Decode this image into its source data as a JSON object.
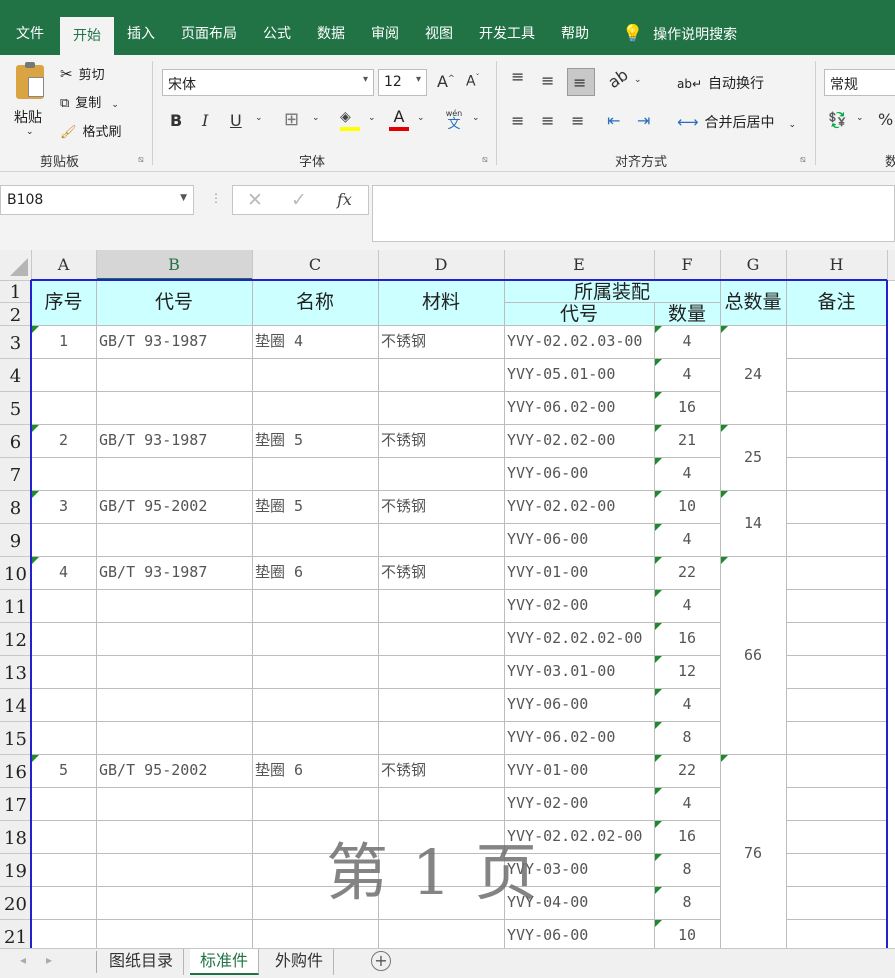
{
  "ribbon_tabs": [
    "文件",
    "开始",
    "插入",
    "页面布局",
    "公式",
    "数据",
    "审阅",
    "视图",
    "开发工具",
    "帮助"
  ],
  "tell_me": "操作说明搜索",
  "clipboard": {
    "paste": "粘贴",
    "cut": "剪切",
    "copy": "复制",
    "format_painter": "格式刷",
    "label": "剪贴板"
  },
  "font": {
    "name": "宋体",
    "size": "12",
    "label": "字体",
    "bold": "B",
    "italic": "I",
    "underline": "U",
    "grow": "A",
    "shrink": "A",
    "phonetic_top": "wén",
    "phonetic_bottom": "文"
  },
  "alignment": {
    "wrap": "自动换行",
    "merge": "合并后居中",
    "label": "对齐方式"
  },
  "number": {
    "format": "常规",
    "label": "数"
  },
  "name_box": "B108",
  "fx": "fx",
  "columns": [
    "A",
    "B",
    "C",
    "D",
    "E",
    "F",
    "G",
    "H"
  ],
  "rows": [
    "1",
    "2",
    "3",
    "4",
    "5",
    "6",
    "7",
    "8",
    "9",
    "10",
    "11",
    "12",
    "13",
    "14",
    "15",
    "16",
    "17",
    "18",
    "19",
    "20",
    "21"
  ],
  "header": {
    "seq": "序号",
    "code": "代号",
    "name": "名称",
    "material": "材料",
    "assembly": "所属装配",
    "asm_code": "代号",
    "qty": "数量",
    "total": "总数量",
    "remark": "备注"
  },
  "items": [
    {
      "seq": "1",
      "code": "GB/T 93-1987",
      "name": "垫圈 4",
      "material": "不锈钢",
      "total": "24",
      "lines": [
        [
          "YVY-02.02.03-00",
          "4"
        ],
        [
          "YVY-05.01-00",
          "4"
        ],
        [
          "YVY-06.02-00",
          "16"
        ]
      ]
    },
    {
      "seq": "2",
      "code": "GB/T 93-1987",
      "name": "垫圈 5",
      "material": "不锈钢",
      "total": "25",
      "lines": [
        [
          "YVY-02.02-00",
          "21"
        ],
        [
          "YVY-06-00",
          "4"
        ]
      ]
    },
    {
      "seq": "3",
      "code": "GB/T 95-2002",
      "name": "垫圈 5",
      "material": "不锈钢",
      "total": "14",
      "lines": [
        [
          "YVY-02.02-00",
          "10"
        ],
        [
          "YVY-06-00",
          "4"
        ]
      ]
    },
    {
      "seq": "4",
      "code": "GB/T 93-1987",
      "name": "垫圈 6",
      "material": "不锈钢",
      "total": "66",
      "lines": [
        [
          "YVY-01-00",
          "22"
        ],
        [
          "YVY-02-00",
          "4"
        ],
        [
          "YVY-02.02.02-00",
          "16"
        ],
        [
          "YVY-03.01-00",
          "12"
        ],
        [
          "YVY-06-00",
          "4"
        ],
        [
          "YVY-06.02-00",
          "8"
        ]
      ]
    },
    {
      "seq": "5",
      "code": "GB/T 95-2002",
      "name": "垫圈 6",
      "material": "不锈钢",
      "total": "76",
      "lines": [
        [
          "YVY-01-00",
          "22"
        ],
        [
          "YVY-02-00",
          "4"
        ],
        [
          "YVY-02.02.02-00",
          "16"
        ],
        [
          "YVY-03-00",
          "8"
        ],
        [
          "YVY-04-00",
          "8"
        ],
        [
          "YVY-06-00",
          "10"
        ]
      ]
    }
  ],
  "watermark": "第 1 页",
  "sheet_tabs": [
    "图纸目录",
    "标准件",
    "外购件"
  ],
  "active_sheet": "标准件",
  "colors": {
    "accent": "#217346",
    "header_fill": "#ccffff",
    "page_border": "#2222cc",
    "comment_marker": "#1e8a2e"
  }
}
